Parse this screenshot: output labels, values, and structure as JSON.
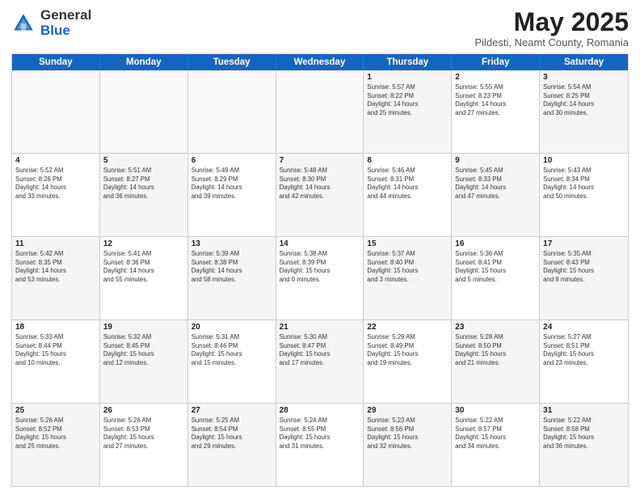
{
  "header": {
    "logo_general": "General",
    "logo_blue": "Blue",
    "month_title": "May 2025",
    "subtitle": "Pildesti, Neamt County, Romania"
  },
  "weekdays": [
    "Sunday",
    "Monday",
    "Tuesday",
    "Wednesday",
    "Thursday",
    "Friday",
    "Saturday"
  ],
  "weeks": [
    [
      {
        "day": "",
        "info": "",
        "empty": true
      },
      {
        "day": "",
        "info": "",
        "empty": true
      },
      {
        "day": "",
        "info": "",
        "empty": true
      },
      {
        "day": "",
        "info": "",
        "empty": true
      },
      {
        "day": "1",
        "info": "Sunrise: 5:57 AM\nSunset: 8:22 PM\nDaylight: 14 hours\nand 25 minutes."
      },
      {
        "day": "2",
        "info": "Sunrise: 5:55 AM\nSunset: 8:23 PM\nDaylight: 14 hours\nand 27 minutes."
      },
      {
        "day": "3",
        "info": "Sunrise: 5:54 AM\nSunset: 8:25 PM\nDaylight: 14 hours\nand 30 minutes."
      }
    ],
    [
      {
        "day": "4",
        "info": "Sunrise: 5:52 AM\nSunset: 8:26 PM\nDaylight: 14 hours\nand 33 minutes."
      },
      {
        "day": "5",
        "info": "Sunrise: 5:51 AM\nSunset: 8:27 PM\nDaylight: 14 hours\nand 36 minutes."
      },
      {
        "day": "6",
        "info": "Sunrise: 5:49 AM\nSunset: 8:29 PM\nDaylight: 14 hours\nand 39 minutes."
      },
      {
        "day": "7",
        "info": "Sunrise: 5:48 AM\nSunset: 8:30 PM\nDaylight: 14 hours\nand 42 minutes."
      },
      {
        "day": "8",
        "info": "Sunrise: 5:46 AM\nSunset: 8:31 PM\nDaylight: 14 hours\nand 44 minutes."
      },
      {
        "day": "9",
        "info": "Sunrise: 5:45 AM\nSunset: 8:33 PM\nDaylight: 14 hours\nand 47 minutes."
      },
      {
        "day": "10",
        "info": "Sunrise: 5:43 AM\nSunset: 8:34 PM\nDaylight: 14 hours\nand 50 minutes."
      }
    ],
    [
      {
        "day": "11",
        "info": "Sunrise: 5:42 AM\nSunset: 8:35 PM\nDaylight: 14 hours\nand 53 minutes."
      },
      {
        "day": "12",
        "info": "Sunrise: 5:41 AM\nSunset: 8:36 PM\nDaylight: 14 hours\nand 55 minutes."
      },
      {
        "day": "13",
        "info": "Sunrise: 5:39 AM\nSunset: 8:38 PM\nDaylight: 14 hours\nand 58 minutes."
      },
      {
        "day": "14",
        "info": "Sunrise: 5:38 AM\nSunset: 8:39 PM\nDaylight: 15 hours\nand 0 minutes."
      },
      {
        "day": "15",
        "info": "Sunrise: 5:37 AM\nSunset: 8:40 PM\nDaylight: 15 hours\nand 3 minutes."
      },
      {
        "day": "16",
        "info": "Sunrise: 5:36 AM\nSunset: 8:41 PM\nDaylight: 15 hours\nand 5 minutes."
      },
      {
        "day": "17",
        "info": "Sunrise: 5:35 AM\nSunset: 8:43 PM\nDaylight: 15 hours\nand 8 minutes."
      }
    ],
    [
      {
        "day": "18",
        "info": "Sunrise: 5:33 AM\nSunset: 8:44 PM\nDaylight: 15 hours\nand 10 minutes."
      },
      {
        "day": "19",
        "info": "Sunrise: 5:32 AM\nSunset: 8:45 PM\nDaylight: 15 hours\nand 12 minutes."
      },
      {
        "day": "20",
        "info": "Sunrise: 5:31 AM\nSunset: 8:46 PM\nDaylight: 15 hours\nand 15 minutes."
      },
      {
        "day": "21",
        "info": "Sunrise: 5:30 AM\nSunset: 8:47 PM\nDaylight: 15 hours\nand 17 minutes."
      },
      {
        "day": "22",
        "info": "Sunrise: 5:29 AM\nSunset: 8:49 PM\nDaylight: 15 hours\nand 19 minutes."
      },
      {
        "day": "23",
        "info": "Sunrise: 5:28 AM\nSunset: 8:50 PM\nDaylight: 15 hours\nand 21 minutes."
      },
      {
        "day": "24",
        "info": "Sunrise: 5:27 AM\nSunset: 8:51 PM\nDaylight: 15 hours\nand 23 minutes."
      }
    ],
    [
      {
        "day": "25",
        "info": "Sunrise: 5:26 AM\nSunset: 8:52 PM\nDaylight: 15 hours\nand 25 minutes."
      },
      {
        "day": "26",
        "info": "Sunrise: 5:26 AM\nSunset: 8:53 PM\nDaylight: 15 hours\nand 27 minutes."
      },
      {
        "day": "27",
        "info": "Sunrise: 5:25 AM\nSunset: 8:54 PM\nDaylight: 15 hours\nand 29 minutes."
      },
      {
        "day": "28",
        "info": "Sunrise: 5:24 AM\nSunset: 8:55 PM\nDaylight: 15 hours\nand 31 minutes."
      },
      {
        "day": "29",
        "info": "Sunrise: 5:23 AM\nSunset: 8:56 PM\nDaylight: 15 hours\nand 32 minutes."
      },
      {
        "day": "30",
        "info": "Sunrise: 5:22 AM\nSunset: 8:57 PM\nDaylight: 15 hours\nand 34 minutes."
      },
      {
        "day": "31",
        "info": "Sunrise: 5:22 AM\nSunset: 8:58 PM\nDaylight: 15 hours\nand 36 minutes."
      }
    ]
  ]
}
